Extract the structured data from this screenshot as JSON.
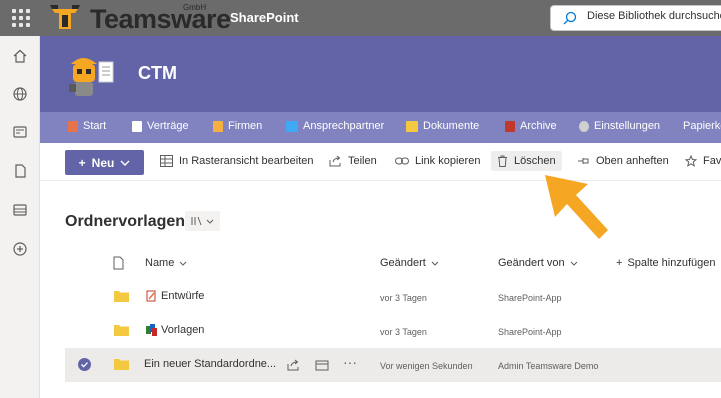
{
  "suite": {
    "brand": "Teamsware",
    "brand_suffix": "GmbH",
    "app": "SharePoint",
    "search_placeholder": "Diese Bibliothek durchsuchen"
  },
  "site": {
    "title": "CTM"
  },
  "nav": {
    "items": [
      {
        "label": "Start",
        "icon": "home-icon"
      },
      {
        "label": "Verträge",
        "icon": "document-icon"
      },
      {
        "label": "Firmen",
        "icon": "handshake-icon"
      },
      {
        "label": "Ansprechpartner",
        "icon": "contact-card-icon"
      },
      {
        "label": "Dokumente",
        "icon": "folder-icon"
      },
      {
        "label": "Archive",
        "icon": "archive-icon"
      },
      {
        "label": "Einstellungen",
        "icon": "gear-icon"
      },
      {
        "label": "Papierkorb",
        "icon": "recycle-bin-icon"
      }
    ]
  },
  "commands": {
    "new": "Neu",
    "grid_edit": "In Rasteransicht bearbeiten",
    "share": "Teilen",
    "copy_link": "Link kopieren",
    "delete": "Löschen",
    "pin": "Oben anheften",
    "favorite": "Favorit"
  },
  "library": {
    "title": "Ordnervorlagen",
    "columns": {
      "name": "Name",
      "modified": "Geändert",
      "modified_by": "Geändert von",
      "add_column": "Spalte hinzufügen"
    },
    "rows": [
      {
        "name": "Entwürfe",
        "modified": "vor 3 Tagen",
        "modified_by": "SharePoint-App",
        "selected": false
      },
      {
        "name": "Vorlagen",
        "modified": "vor 3 Tagen",
        "modified_by": "SharePoint-App",
        "selected": false
      },
      {
        "name": "Ein neuer Standardordne...",
        "modified": "Vor wenigen Sekunden",
        "modified_by": "Admin Teamsware Demo",
        "selected": true
      }
    ]
  },
  "colors": {
    "accent": "#6264a7",
    "nav_bg": "#8182c0",
    "suite_bg": "#6b6b6b",
    "arrow": "#f5a623"
  }
}
